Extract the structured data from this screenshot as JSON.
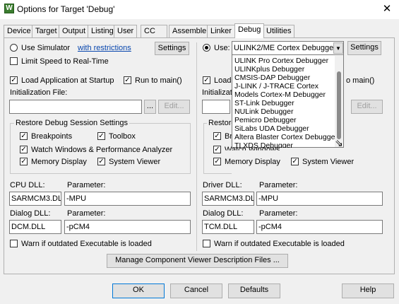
{
  "window": {
    "title": "Options for Target 'Debug'",
    "app_icon": "W",
    "close_glyph": "✕"
  },
  "tabs": [
    "Device",
    "Target",
    "Output",
    "Listing",
    "User",
    "CC",
    "Assembler",
    "Linker",
    "Debug",
    "Utilities"
  ],
  "active_tab": "Debug",
  "left": {
    "use_simulator": "Use Simulator",
    "with_restrictions": "with restrictions",
    "settings": "Settings",
    "limit_speed": "Limit Speed to Real-Time",
    "load_app": "Load Application at Startup",
    "run_to_main": "Run to main()",
    "init_file_label": "Initialization File:",
    "browse": "...",
    "edit": "Edit...",
    "restore_group": "Restore Debug Session Settings",
    "breakpoints": "Breakpoints",
    "toolbox": "Toolbox",
    "watch_windows": "Watch Windows & Performance Analyzer",
    "memory_display": "Memory Display",
    "system_viewer": "System Viewer",
    "cpu_dll_label": "CPU DLL:",
    "cpu_param_label": "Parameter:",
    "cpu_dll": "SARMCM3.DLL",
    "cpu_param": "-MPU",
    "dialog_dll_label": "Dialog DLL:",
    "dialog_param_label": "Parameter:",
    "dialog_dll": "DCM.DLL",
    "dialog_param": "-pCM4",
    "warn": "Warn if outdated Executable is loaded"
  },
  "right": {
    "use": "Use:",
    "selected_debugger": "ULINK2/ME Cortex Debugger",
    "settings": "Settings",
    "load_partial": "Load",
    "run_partial": "o main()",
    "init_partial": "Initializatio",
    "edit": "Edit...",
    "restore_partial": "Restore",
    "br_partial": "Br",
    "watch_partial": "Watch Windows",
    "memory_display": "Memory Display",
    "system_viewer": "System Viewer",
    "driver_dll_label": "Driver DLL:",
    "driver_param_label": "Parameter:",
    "driver_dll": "SARMCM3.DLL",
    "driver_param": "-MPU",
    "dialog_dll_label": "Dialog DLL:",
    "dialog_param_label": "Parameter:",
    "dialog_dll": "TCM.DLL",
    "dialog_param": "-pCM4",
    "warn": "Warn if outdated Executable is loaded"
  },
  "dropdown_options": [
    "ULINK Pro Cortex Debugger",
    "ULINKplus Debugger",
    "CMSIS-DAP Debugger",
    "J-LINK / J-TRACE Cortex",
    "Models Cortex-M Debugger",
    "ST-Link Debugger",
    "NULink Debugger",
    "Pemicro Debugger",
    "SiLabs UDA Debugger",
    "Altera Blaster Cortex Debugger",
    "TI XDS Debugger"
  ],
  "manage_button": "Manage Component Viewer Description Files ...",
  "footer": {
    "ok": "OK",
    "cancel": "Cancel",
    "defaults": "Defaults",
    "help": "Help"
  },
  "glyphs": {
    "check": "✓",
    "dropdown_arrow": "▼",
    "cursor": "⇘"
  }
}
